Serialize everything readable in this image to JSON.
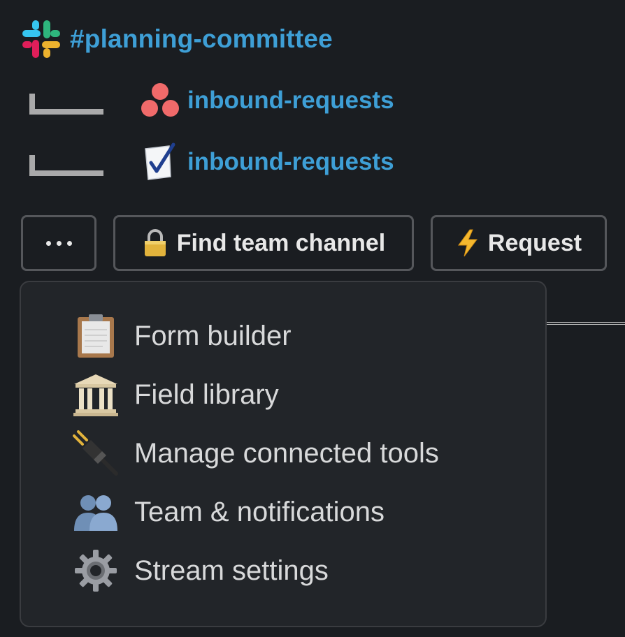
{
  "header": {
    "channel": "#planning-committee",
    "logo_icon": "slack-logo-icon"
  },
  "linked": [
    {
      "icon": "asana-icon",
      "label": "inbound-requests"
    },
    {
      "icon": "checkmark-document-icon",
      "label": "inbound-requests"
    }
  ],
  "toolbar": {
    "more_icon": "ellipsis-icon",
    "find_icon": "lock-icon",
    "find_label": "Find team channel",
    "request_icon": "lightning-icon",
    "request_label": "Request"
  },
  "menu": {
    "items": [
      {
        "icon": "clipboard-icon",
        "label": "Form builder"
      },
      {
        "icon": "classical-building-icon",
        "label": "Field library"
      },
      {
        "icon": "electric-plug-icon",
        "label": "Manage connected tools"
      },
      {
        "icon": "people-icon",
        "label": "Team & notifications"
      },
      {
        "icon": "gear-icon",
        "label": "Stream settings"
      }
    ]
  },
  "colors": {
    "background": "#1a1d21",
    "link": "#3e9fd6",
    "menu_background": "#222529",
    "border": "#55575b"
  }
}
